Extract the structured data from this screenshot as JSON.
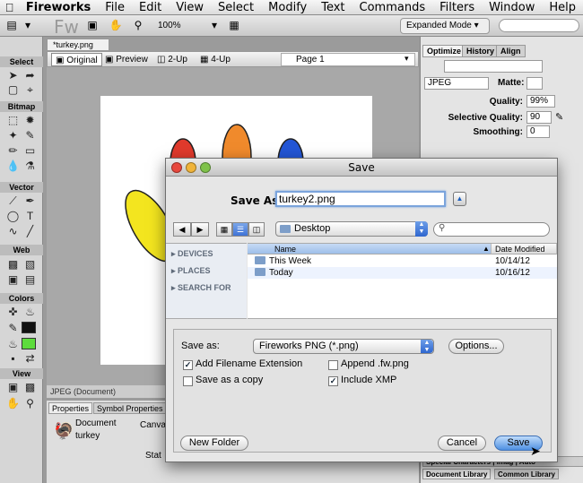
{
  "menubar": {
    "apple": "",
    "items": [
      "Fireworks",
      "File",
      "Edit",
      "View",
      "Select",
      "Modify",
      "Text",
      "Commands",
      "Filters",
      "Window",
      "Help"
    ]
  },
  "appbar": {
    "logo": "Fw",
    "zoom": "100%",
    "mode": "Expanded Mode"
  },
  "tools": {
    "sections": [
      "Select",
      "Bitmap",
      "Vector",
      "Web",
      "Colors",
      "View"
    ],
    "fill_color": "#5ddc3c",
    "stroke_color": "#111111"
  },
  "document": {
    "tab": "*turkey.png",
    "views": [
      "Original",
      "Preview",
      "2-Up",
      "4-Up"
    ],
    "page": "Page 1",
    "status": "JPEG (Document)"
  },
  "properties": {
    "tabs": [
      "Properties",
      "Symbol Properties"
    ],
    "doc_label": "Document",
    "doc_name": "turkey",
    "canvas_label": "Canvas",
    "state_label": "Stat"
  },
  "right_panel": {
    "tabs": [
      "Optimize",
      "History",
      "Align"
    ],
    "format": "JPEG",
    "matte_label": "Matte:",
    "quality_label": "Quality:",
    "quality": "99%",
    "selective_label": "Selective Quality:",
    "selective": "90",
    "smoothing_label": "Smoothing:",
    "smoothing": "0",
    "bottom_tabs": [
      "Special Characters",
      "Imag",
      "Auto"
    ],
    "library_tabs": [
      "Document Library",
      "Common Library"
    ]
  },
  "dialog": {
    "title": "Save",
    "save_as_label": "Save As:",
    "filename": "turkey2.png",
    "location": "Desktop",
    "search_placeholder": "",
    "sidebar": [
      "DEVICES",
      "PLACES",
      "SEARCH FOR"
    ],
    "columns": [
      "Name",
      "Date Modified"
    ],
    "files": [
      {
        "name": "This Week",
        "date": "10/14/12"
      },
      {
        "name": "Today",
        "date": "10/16/12"
      }
    ],
    "format_label": "Save as:",
    "format": "Fireworks PNG (*.png)",
    "options_btn": "Options...",
    "checks": [
      {
        "label": "Add Filename Extension",
        "checked": true
      },
      {
        "label": "Append .fw.png",
        "checked": false
      },
      {
        "label": "Save as a copy",
        "checked": false
      },
      {
        "label": "Include XMP",
        "checked": true
      }
    ],
    "new_folder": "New Folder",
    "cancel": "Cancel",
    "save": "Save"
  }
}
